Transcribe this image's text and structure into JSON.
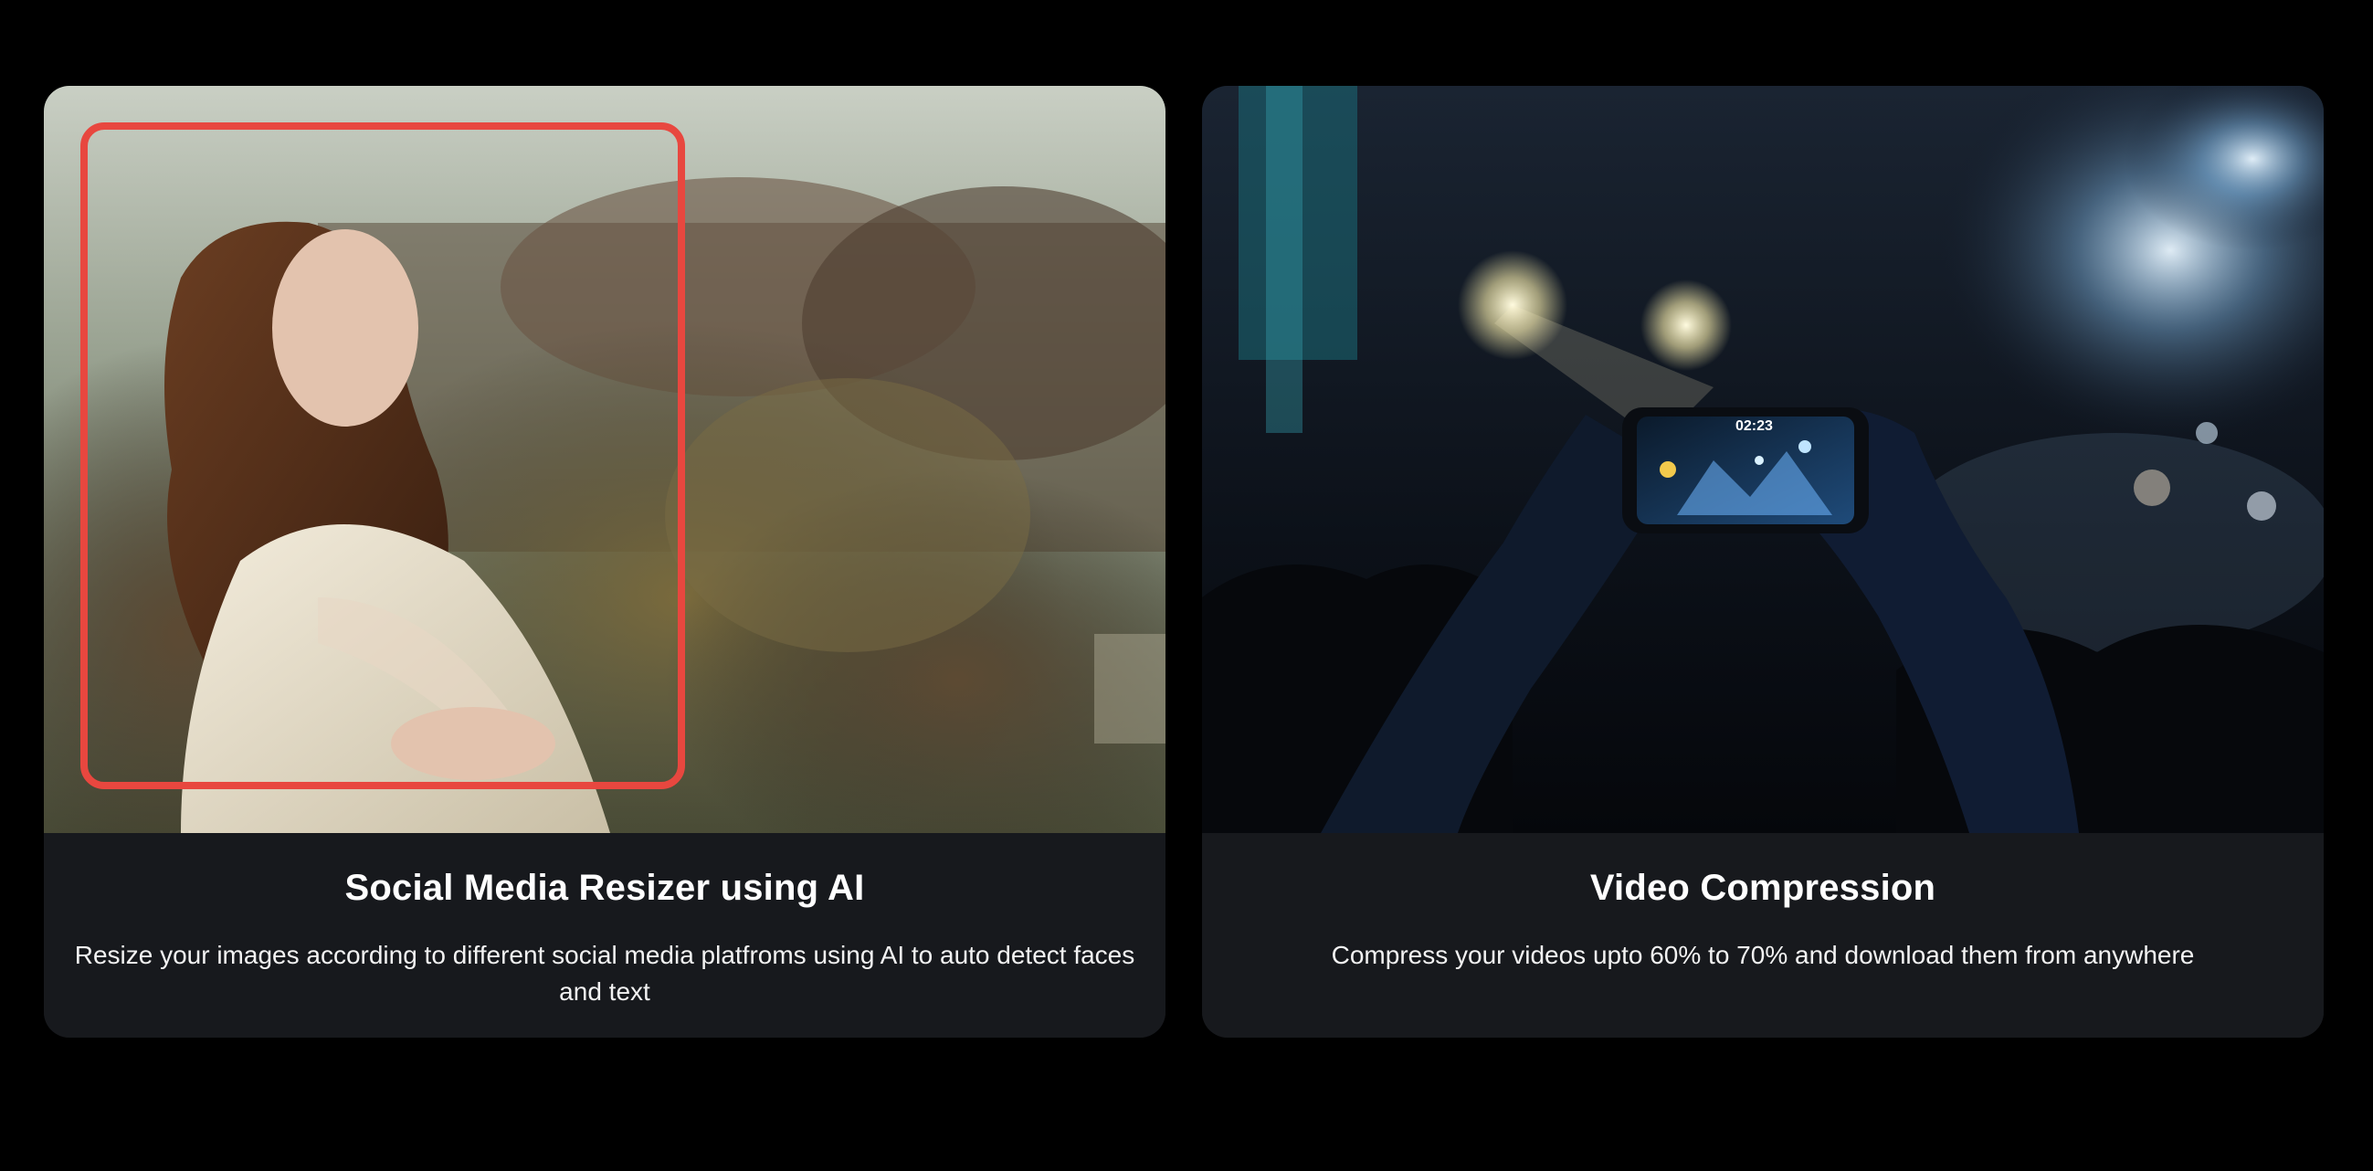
{
  "cards": [
    {
      "title": "Social Media Resizer using AI",
      "description": "Resize your images according to different social media platfroms using AI to auto detect faces and text",
      "image_subject": "woman in white lace shawl outdoors with autumn trees",
      "overlay": "crop frame"
    },
    {
      "title": "Video Compression",
      "description": "Compress your videos upto 60% to 70% and download them from anywhere",
      "image_subject": "hands recording a concert on a smartphone",
      "phone_time": "02:23"
    }
  ],
  "colors": {
    "page_background": "#000000",
    "card_background": "#17191d",
    "crop_frame": "#e8473f",
    "text": "#ffffff"
  }
}
